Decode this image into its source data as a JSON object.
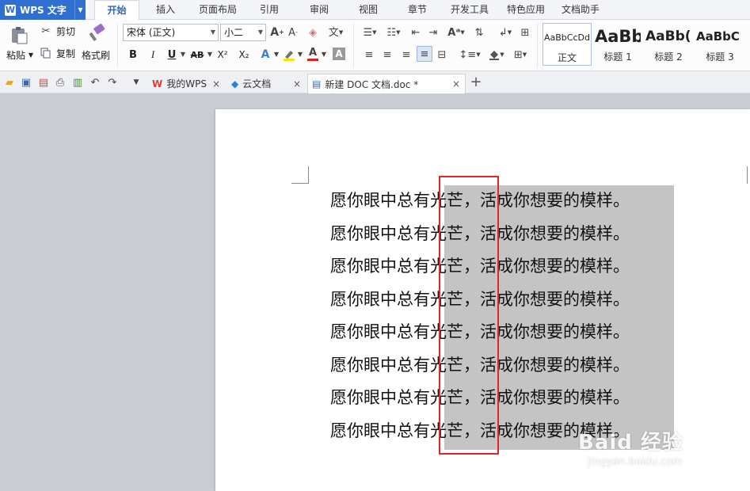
{
  "app": {
    "title": "WPS 文字",
    "logo_letter": "W"
  },
  "menu_tabs": [
    {
      "label": "开始"
    },
    {
      "label": "插入"
    },
    {
      "label": "页面布局"
    },
    {
      "label": "引用"
    },
    {
      "label": "审阅"
    },
    {
      "label": "视图"
    },
    {
      "label": "章节"
    },
    {
      "label": "开发工具"
    },
    {
      "label": "特色应用"
    },
    {
      "label": "文档助手"
    }
  ],
  "active_tab": "开始",
  "ribbon": {
    "paste": "粘贴",
    "cut": "剪切",
    "copy": "复制",
    "format_painter": "格式刷",
    "font_name": "宋体 (正文)",
    "font_size": "小二",
    "bold": "B",
    "italic": "I",
    "underline": "U",
    "strikethrough": "AB",
    "superscript": "X²",
    "subscript": "X₂",
    "font_color_letter": "A",
    "styles": [
      {
        "sample": "AaBbCcDd",
        "name": "正文"
      },
      {
        "sample": "AaBb",
        "name": "标题 1"
      },
      {
        "sample": "AaBb(",
        "name": "标题 2"
      },
      {
        "sample": "AaBbC",
        "name": "标题 3"
      }
    ]
  },
  "doc_tabs": [
    {
      "label": "我的WPS"
    },
    {
      "label": "云文档"
    },
    {
      "label": "新建 DOC 文档.doc *"
    }
  ],
  "document": {
    "lines": [
      "愿你眼中总有光芒，活成你想要的模样。",
      "愿你眼中总有光芒，活成你想要的模样。",
      "愿你眼中总有光芒，活成你想要的模样。",
      "愿你眼中总有光芒，活成你想要的模样。",
      "愿你眼中总有光芒，活成你想要的模样。",
      "愿你眼中总有光芒，活成你想要的模样。",
      "愿你眼中总有光芒，活成你想要的模样。",
      "愿你眼中总有光芒，活成你想要的模样。"
    ]
  },
  "watermark": {
    "main": "Baid 经验",
    "sub": "jingyan.baidu.com"
  },
  "colors": {
    "accent": "#2e6fd1",
    "selection": "#c4c4c4",
    "highlight_box": "#e0262a"
  }
}
